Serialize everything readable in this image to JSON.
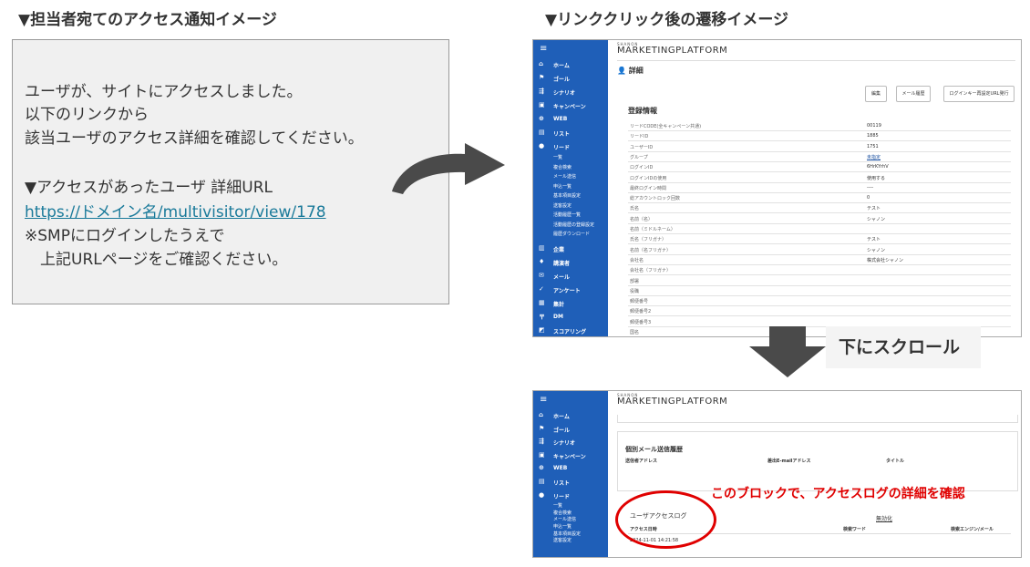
{
  "headings": {
    "left": "▼担当者宛てのアクセス通知イメージ",
    "right": "▼リンククリック後の遷移イメージ"
  },
  "email": {
    "line1": "ユーザが、サイトにアクセスしました。",
    "line2": "以下のリンクから",
    "line3": "該当ユーザのアクセス詳細を確認してください。",
    "line4": "▼アクセスがあったユーザ 詳細URL",
    "link": "https://ドメイン名/multivisitor/view/178",
    "line5": "※SMPにログインしたうえで",
    "line6": "上記URLページをご確認ください。"
  },
  "scroll_label": "下にスクロール",
  "red_note": "このブロックで、アクセスログの詳細を確認",
  "app": {
    "brand_small": "SHANON",
    "brand": "MARKETINGPLATFORM",
    "menu_icon": "≡",
    "sidebar_top": [
      {
        "icon": "⌂",
        "label": "ホーム"
      },
      {
        "icon": "⚑",
        "label": "ゴール"
      },
      {
        "icon": "⇶",
        "label": "シナリオ"
      },
      {
        "icon": "▣",
        "label": "キャンペーン"
      },
      {
        "icon": "⊕",
        "label": "WEB"
      },
      {
        "icon": "▤",
        "label": "リスト"
      },
      {
        "icon": "●",
        "label": "リード"
      }
    ],
    "sidebar_sub": [
      "一覧",
      "複合検索",
      "メール送信",
      "申込一覧",
      "基本項目設定",
      "送客設定",
      "活動履歴一覧",
      "活動履歴の登録設定",
      "履歴ダウンロード"
    ],
    "sidebar_bottom": [
      {
        "icon": "▥",
        "label": "企業"
      },
      {
        "icon": "♦",
        "label": "講演者"
      },
      {
        "icon": "✉",
        "label": "メール"
      },
      {
        "icon": "✓",
        "label": "アンケート"
      },
      {
        "icon": "▦",
        "label": "集計"
      },
      {
        "icon": "〒",
        "label": "DM"
      },
      {
        "icon": "◩",
        "label": "スコアリング"
      }
    ],
    "detail_title": "詳細",
    "buttons": {
      "edit": "編集",
      "mail_history": "メール履歴",
      "login_key": "ログインキー再設定URL発行"
    },
    "section_title": "登録情報",
    "rows": [
      {
        "k": "リードCODE(全キャンペーン共通)",
        "v": "00119"
      },
      {
        "k": "リードID",
        "v": "1885"
      },
      {
        "k": "ユーザーID",
        "v": "1751"
      },
      {
        "k": "グループ",
        "v": "未指定"
      },
      {
        "k": "ログインID",
        "v": "6HrKYrhV"
      },
      {
        "k": "ログインIDの使用",
        "v": "使用する"
      },
      {
        "k": "最終ログイン時間",
        "v": "----"
      },
      {
        "k": "総アカウントロック回数",
        "v": "0"
      },
      {
        "k": "氏名",
        "v": "テスト"
      },
      {
        "k": "名前（名）",
        "v": "シャノン"
      },
      {
        "k": "名前（ミドルネーム）",
        "v": ""
      },
      {
        "k": "氏名（フリガナ）",
        "v": "テスト"
      },
      {
        "k": "名前（名フリガナ）",
        "v": "シャノン"
      },
      {
        "k": "会社名",
        "v": "株式会社シャノン"
      },
      {
        "k": "会社名（フリガナ）",
        "v": ""
      },
      {
        "k": "部署",
        "v": ""
      },
      {
        "k": "役職",
        "v": ""
      },
      {
        "k": "郵便番号",
        "v": ""
      },
      {
        "k": "郵便番号2",
        "v": ""
      },
      {
        "k": "郵便番号3",
        "v": ""
      },
      {
        "k": "国名",
        "v": ""
      }
    ],
    "sidebar_sub_bottom": [
      "一覧",
      "複合検索",
      "メール送信",
      "申込一覧",
      "基本項目設定",
      "送客設定"
    ],
    "mail_history": {
      "title": "個別メール送信履歴",
      "col_sender": "送信者アドレス",
      "col_from": "差出E-mailアドレス",
      "col_title": "タイトル"
    },
    "access_log": {
      "title": "ユーザアクセスログ",
      "disable": "無効化",
      "col_datetime": "アクセス日時",
      "col_keyword": "検索ワード",
      "col_engine": "検索エンジン/メール",
      "date": "2024-11-01 14:21:58"
    }
  },
  "colors": {
    "sidebar": "#1f5fb8",
    "accent_red": "#e00000",
    "link": "#1a7a9a"
  }
}
